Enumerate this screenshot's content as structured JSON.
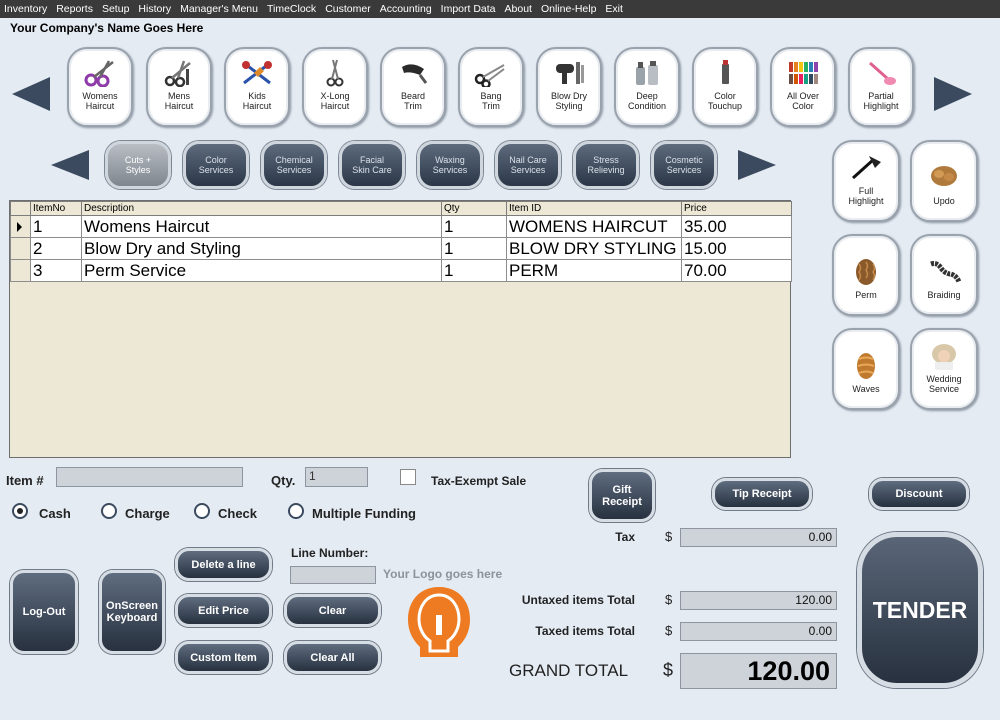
{
  "menu": [
    "Inventory",
    "Reports",
    "Setup",
    "History",
    "Manager's Menu",
    "TimeClock",
    "Customer",
    "Accounting",
    "Import Data",
    "About",
    "Online-Help",
    "Exit"
  ],
  "company_name": "Your Company's Name Goes Here",
  "services": [
    {
      "label": "Womens\nHaircut",
      "icon": "scissors-icon"
    },
    {
      "label": "Mens\nHaircut",
      "icon": "scissors-comb-icon"
    },
    {
      "label": "Kids\nHaircut",
      "icon": "kids-scissors-icon"
    },
    {
      "label": "X-Long\nHaircut",
      "icon": "long-scissors-icon"
    },
    {
      "label": "Beard\nTrim",
      "icon": "trimmer-icon"
    },
    {
      "label": "Bang\nTrim",
      "icon": "shears-icon"
    },
    {
      "label": "Blow Dry\nStyling",
      "icon": "hair-dryer-icon"
    },
    {
      "label": "Deep\nCondition",
      "icon": "bottles-icon"
    },
    {
      "label": "Color\nTouchup",
      "icon": "color-tube-icon"
    },
    {
      "label": "All Over\nColor",
      "icon": "color-swatch-icon"
    },
    {
      "label": "Partial\nHighlight",
      "icon": "highlight-brush-icon"
    }
  ],
  "side_services": [
    {
      "label": "Full\nHighlight",
      "icon": "foil-brush-icon"
    },
    {
      "label": "Updo",
      "icon": "updo-hair-icon"
    },
    {
      "label": "Perm",
      "icon": "perm-hair-icon"
    },
    {
      "label": "Braiding",
      "icon": "braid-icon"
    },
    {
      "label": "Waves",
      "icon": "waves-hair-icon"
    },
    {
      "label": "Wedding\nService",
      "icon": "bride-icon"
    }
  ],
  "categories": [
    "Cuts +\nStyles",
    "Color\nServices",
    "Chemical\nServices",
    "Facial\nSkin Care",
    "Waxing\nServices",
    "Nail Care\nServices",
    "Stress\nRelieving",
    "Cosmetic\nServices"
  ],
  "grid": {
    "headers": [
      "ItemNo",
      "Description",
      "Qty",
      "Item ID",
      "Price"
    ],
    "rows": [
      [
        "1",
        "Womens Haircut",
        "1",
        "WOMENS HAIRCUT",
        "35.00"
      ],
      [
        "2",
        "Blow Dry and Styling",
        "1",
        "BLOW DRY STYLING",
        "15.00"
      ],
      [
        "3",
        "Perm Service",
        "1",
        "PERM",
        "70.00"
      ]
    ]
  },
  "item_label": "Item #",
  "item_value": "",
  "qty_label": "Qty.",
  "qty_value": "1",
  "tax_exempt_label": "Tax-Exempt Sale",
  "payment": {
    "cash": "Cash",
    "charge": "Charge",
    "check": "Check",
    "multiple": "Multiple Funding"
  },
  "buttons": {
    "gift_receipt": "Gift\nReceipt",
    "tip_receipt": "Tip Receipt",
    "discount": "Discount",
    "logout": "Log-Out",
    "onscreen_keyboard": "OnScreen\nKeyboard",
    "delete_line": "Delete a line",
    "edit_price": "Edit Price",
    "custom_item": "Custom Item",
    "clear": "Clear",
    "clear_all": "Clear All",
    "tender": "TENDER"
  },
  "line_number_label": "Line Number:",
  "logo_text": "Your Logo goes here",
  "totals": {
    "tax_label": "Tax",
    "tax": "0.00",
    "untaxed_label": "Untaxed items Total",
    "untaxed": "120.00",
    "taxed_label": "Taxed items Total",
    "taxed": "0.00",
    "grand_label": "GRAND TOTAL",
    "currency": "$",
    "grand": "120.00"
  }
}
